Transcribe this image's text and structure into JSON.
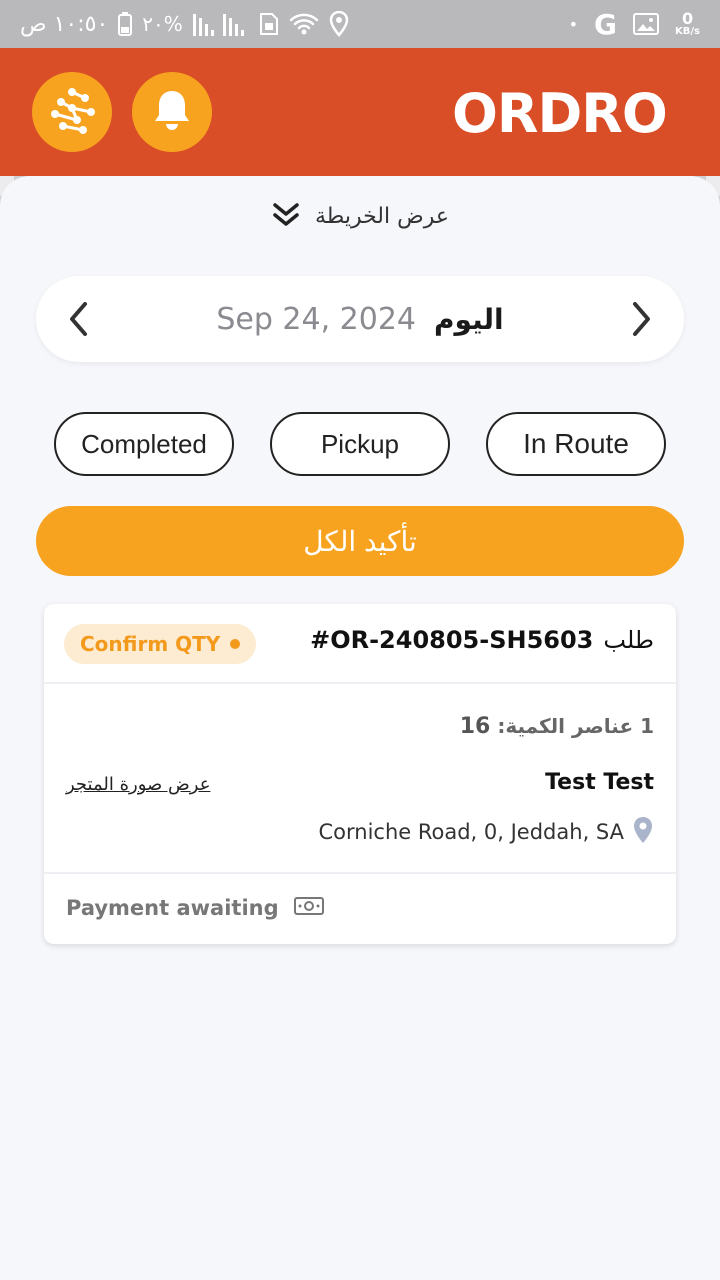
{
  "status_bar": {
    "time": "١٠:٥٠ ص",
    "battery": "٢٠%",
    "speed_value": "0",
    "speed_unit": "KB/s"
  },
  "header": {
    "logo_text": "ORDRO",
    "brand_color": "#d94e26",
    "accent_color": "#f7a320",
    "left_buttons": [
      "network-icon",
      "bell-icon"
    ]
  },
  "map_toggle": {
    "label": "عرض الخريطة",
    "icon": "chevron-double-down-icon"
  },
  "date_bar": {
    "today_label": "اليوم",
    "date": "Sep 24, 2024"
  },
  "filters": [
    {
      "label": "Completed"
    },
    {
      "label": "Pickup"
    },
    {
      "label": "In Route"
    }
  ],
  "confirm_all_label": "تأكيد الكل",
  "order": {
    "prefix": "طلب",
    "id": "#OR-240805-SH5603",
    "status": "Confirm QTY",
    "qty_label": "1 عناصر الكمية:",
    "qty_value": "16",
    "customer": "Test Test",
    "store_image_link": "عرض صورة المتجر",
    "address": "Corniche Road, 0, Jeddah, SA",
    "payment": "Payment awaiting"
  }
}
